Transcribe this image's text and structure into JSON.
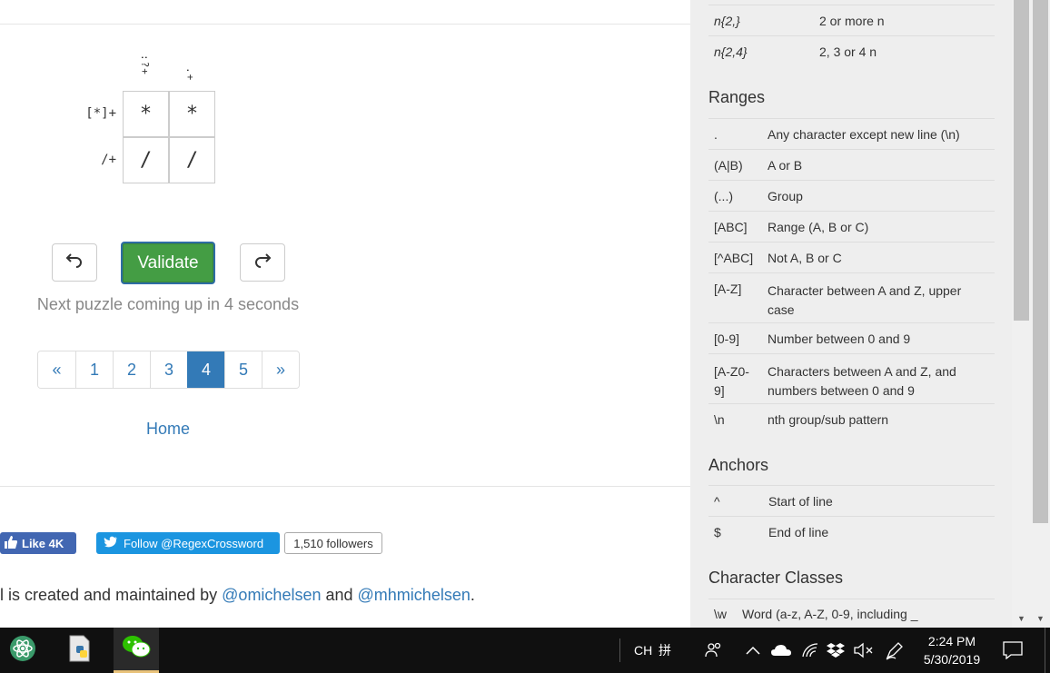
{
  "puzzle": {
    "col_clues": [
      ":?+",
      ".+"
    ],
    "row_clues": [
      "[*]+",
      "/+"
    ],
    "cells": [
      [
        "*",
        "*"
      ],
      [
        "/",
        "/"
      ]
    ]
  },
  "controls": {
    "undo_icon": "undo-icon",
    "redo_icon": "redo-icon",
    "validate_label": "Validate",
    "next_text": "Next puzzle coming up in 4 seconds"
  },
  "pagination": {
    "prev": "«",
    "pages": [
      "1",
      "2",
      "3",
      "4",
      "5"
    ],
    "active": "4",
    "next": "»"
  },
  "home_label": "Home",
  "social": {
    "fb_label": "Like 4K",
    "tw_label": "Follow @RegexCrossword",
    "tw_count": "1,510 followers"
  },
  "credit": {
    "prefix": "l is created and maintained by ",
    "author1": "@omichelsen",
    "mid": " and ",
    "author2": "@mhmichelsen",
    "suffix": "."
  },
  "cheatsheet": {
    "quantifiers_tail": [
      {
        "k": "n{2,}",
        "v": "2 or more n"
      },
      {
        "k": "n{2,4}",
        "v": "2, 3 or 4 n"
      }
    ],
    "ranges_title": "Ranges",
    "ranges": [
      {
        "k": ".",
        "v": "Any character except new line (\\n)"
      },
      {
        "k": "(A|B)",
        "v": "A or B"
      },
      {
        "k": "(...)",
        "v": "Group"
      },
      {
        "k": "[ABC]",
        "v": "Range (A, B or C)"
      },
      {
        "k": "[^ABC]",
        "v": "Not A, B or C"
      },
      {
        "k": "[A-Z]",
        "v": "Character between A and Z, upper case"
      },
      {
        "k": "[0-9]",
        "v": "Number between 0 and 9"
      },
      {
        "k": "[A-Z0-9]",
        "v": "Characters between A and Z, and numbers between 0 and 9"
      },
      {
        "k": "\\n",
        "v": "nth group/sub pattern"
      }
    ],
    "anchors_title": "Anchors",
    "anchors": [
      {
        "k": "^",
        "v": "Start of line"
      },
      {
        "k": "$",
        "v": "End of line"
      }
    ],
    "classes_title": "Character Classes",
    "classes": [
      {
        "k": "\\w",
        "v": "Word (a-z, A-Z, 0-9, including _"
      }
    ]
  },
  "taskbar": {
    "apps": [
      "atom-icon",
      "python-file-icon",
      "wechat-icon"
    ],
    "ime_lang": "CH",
    "ime_mode": "拼",
    "time": "2:24 PM",
    "date": "5/30/2019"
  },
  "colors": {
    "accent": "#337ab7",
    "validate": "#449d44",
    "sidebar_bg": "#eeeeee",
    "taskbar_bg": "#101010"
  }
}
